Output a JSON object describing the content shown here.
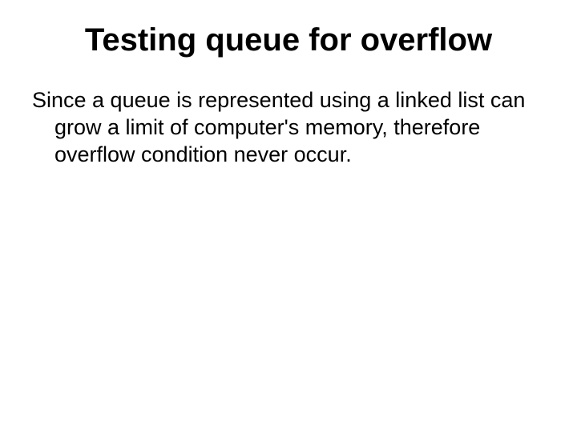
{
  "slide": {
    "title": "Testing queue for overflow",
    "body": "Since a queue is represented using a linked list can grow a limit of computer's memory, therefore overflow condition never occur."
  }
}
